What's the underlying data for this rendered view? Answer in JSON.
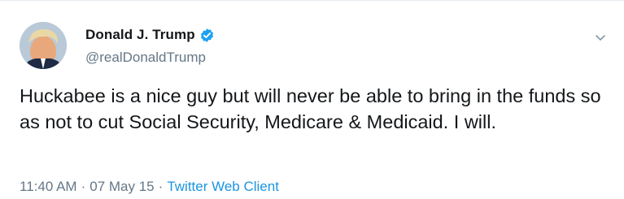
{
  "author": {
    "display_name": "Donald J. Trump",
    "handle": "@realDonaldTrump",
    "verified": true,
    "avatar_icon": "profile-photo",
    "verified_icon": "verified-badge-icon"
  },
  "tweet": {
    "text": "Huckabee is a nice guy but will never be able to bring in the funds so as not to cut Social Security, Medicare & Medicaid. I will.",
    "time": "11:40 AM",
    "separator": "·",
    "date": "07 May 15",
    "client": "Twitter Web Client"
  },
  "menu": {
    "icon": "chevron-down-icon"
  },
  "colors": {
    "text": "#14171a",
    "secondary": "#657786",
    "link": "#1b95e0",
    "verified": "#1da1f2"
  }
}
